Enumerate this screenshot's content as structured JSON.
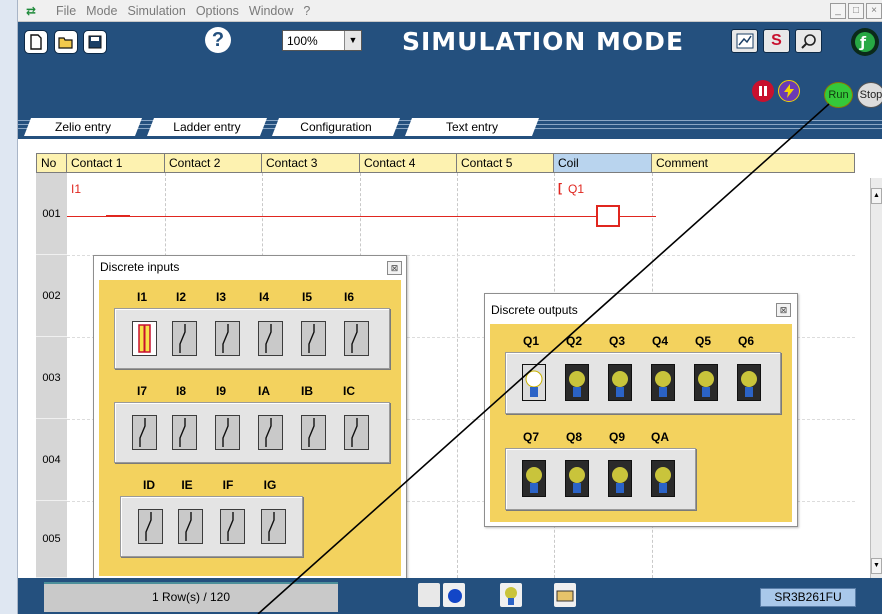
{
  "menu": {
    "items": [
      "File",
      "Mode",
      "Simulation",
      "Options",
      "Window",
      "?"
    ],
    "window_controls": [
      "_",
      "□",
      "×"
    ]
  },
  "toolbar": {
    "zoom_value": "100%",
    "mode_title": "SIMULATION MODE",
    "s_button_label": "S",
    "run_label": "Run",
    "stop_label": "Stop"
  },
  "tabs": [
    "Zelio entry",
    "Ladder entry",
    "Configuration",
    "Text entry"
  ],
  "grid": {
    "headers": [
      "No",
      "Contact 1",
      "Contact 2",
      "Contact 3",
      "Contact 4",
      "Contact 5",
      "Coil",
      "Comment"
    ],
    "rows": [
      "001",
      "002",
      "003",
      "004",
      "005"
    ],
    "contact_label": "I1",
    "coil_label": "Q1",
    "coil_bracket": "["
  },
  "discrete_inputs": {
    "title": "Discrete inputs",
    "close": "⊠",
    "rows": [
      [
        "I1",
        "I2",
        "I3",
        "I4",
        "I5",
        "I6"
      ],
      [
        "I7",
        "I8",
        "I9",
        "IA",
        "IB",
        "IC"
      ],
      [
        "ID",
        "IE",
        "IF",
        "IG"
      ]
    ],
    "active": [
      "I1"
    ]
  },
  "discrete_outputs": {
    "title": "Discrete outputs",
    "close": "⊠",
    "rows": [
      [
        "Q1",
        "Q2",
        "Q3",
        "Q4",
        "Q5",
        "Q6"
      ],
      [
        "Q7",
        "Q8",
        "Q9",
        "QA"
      ]
    ],
    "active": [
      "Q1"
    ]
  },
  "status": {
    "rows_text": "1 Row(s) / 120",
    "module": "SR3B261FU"
  },
  "colors": {
    "toolbar_bg": "#24507e",
    "panel_body": "#f3d25e",
    "header_bg": "#fdf2b0",
    "coil_header": "#b9d4ee",
    "rung_red": "#e0261f",
    "run_green": "#35c93a"
  }
}
